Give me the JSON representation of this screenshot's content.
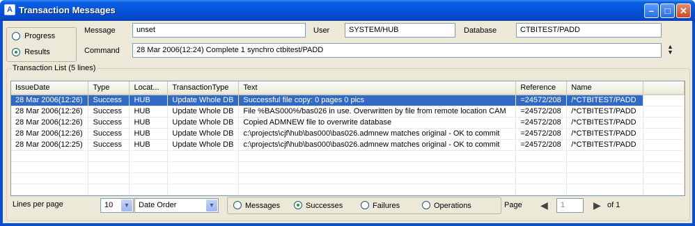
{
  "window": {
    "title": "Transaction Messages",
    "icon": "app-icon",
    "controls": [
      "minimize",
      "maximize",
      "close"
    ]
  },
  "mode": {
    "options": [
      {
        "label": "Progress",
        "selected": false
      },
      {
        "label": "Results",
        "selected": true
      }
    ]
  },
  "header": {
    "message_label": "Message",
    "message_value": "unset",
    "user_label": "User",
    "user_value": "SYSTEM/HUB",
    "database_label": "Database",
    "database_value": "CTBITEST/PADD",
    "command_label": "Command",
    "command_value": "28 Mar 2006(12:24)  Complete  1  synchro ctbitest/PADD"
  },
  "transactions": {
    "legend": "Transaction List (5 lines)",
    "columns": [
      "IssueDate",
      "Type",
      "Locat...",
      "TransactionType",
      "Text",
      "Reference",
      "Name"
    ],
    "rows": [
      [
        "28 Mar 2006(12:26)",
        "Success",
        "HUB",
        "Update Whole DB",
        "Successful file copy:  0 pages 0 pics",
        "=24572/208",
        "/*CTBITEST/PADD"
      ],
      [
        "28 Mar 2006(12:26)",
        "Success",
        "HUB",
        "Update Whole DB",
        "File %BAS000%/bas026 in use. Overwritten by file from remote location CAM",
        "=24572/208",
        "/*CTBITEST/PADD"
      ],
      [
        "28 Mar 2006(12:26)",
        "Success",
        "HUB",
        "Update Whole DB",
        "Copied ADMNEW file to overwrite database",
        "=24572/208",
        "/*CTBITEST/PADD"
      ],
      [
        "28 Mar 2006(12:26)",
        "Success",
        "HUB",
        "Update Whole DB",
        "c:\\projects\\cjf\\hub\\bas000\\bas026.admnew matches original - OK to commit",
        "=24572/208",
        "/*CTBITEST/PADD"
      ],
      [
        "28 Mar 2006(12:25)",
        "Success",
        "HUB",
        "Update Whole DB",
        "c:\\projects\\cjf\\hub\\bas000\\bas026.admnew matches original - OK to commit",
        "=24572/208",
        "/*CTBITEST/PADD"
      ]
    ],
    "selected_row": 0
  },
  "footer": {
    "lines_label": "Lines per page",
    "lines_value": "10",
    "order_value": "Date Order",
    "filters": [
      {
        "label": "Messages",
        "selected": false
      },
      {
        "label": "Successes",
        "selected": true
      },
      {
        "label": "Failures",
        "selected": false
      },
      {
        "label": "Operations",
        "selected": false
      }
    ],
    "page_label": "Page",
    "page_value": "1",
    "page_of": "of 1"
  },
  "colors": {
    "title_bar": "#0553d8",
    "selection": "#316ac5",
    "dialog_bg": "#ece9d8"
  }
}
